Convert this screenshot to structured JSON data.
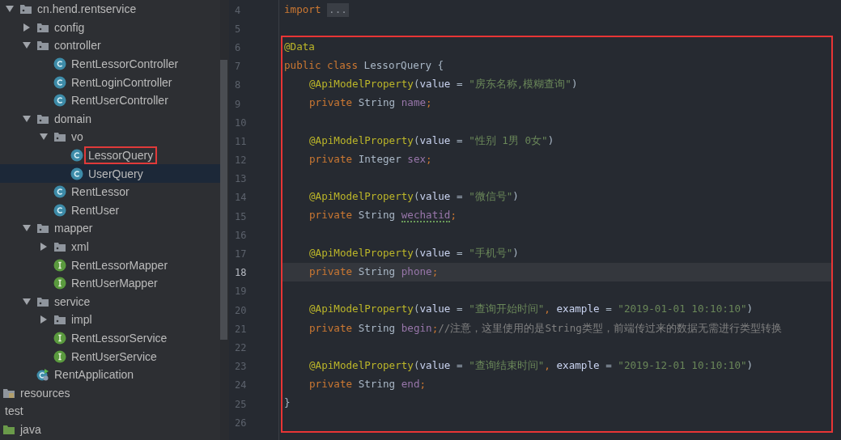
{
  "project_tree": {
    "packages": [
      {
        "label": "cn.hend.rentservice",
        "kind": "package",
        "expanded": true,
        "children": [
          {
            "label": "config",
            "kind": "package",
            "expanded": false
          },
          {
            "label": "controller",
            "kind": "package",
            "expanded": true,
            "children": [
              {
                "label": "RentLessorController",
                "kind": "class",
                "selected": false
              },
              {
                "label": "RentLoginController",
                "kind": "class",
                "selected": false
              },
              {
                "label": "RentUserController",
                "kind": "class",
                "selected": false
              }
            ]
          },
          {
            "label": "domain",
            "kind": "package",
            "expanded": true,
            "children": [
              {
                "label": "vo",
                "kind": "package",
                "expanded": true,
                "children": [
                  {
                    "label": "LessorQuery",
                    "kind": "class",
                    "selected": false,
                    "marked": true
                  },
                  {
                    "label": "UserQuery",
                    "kind": "class",
                    "selected": true
                  }
                ]
              },
              {
                "label": "RentLessor",
                "kind": "class",
                "selected": false
              },
              {
                "label": "RentUser",
                "kind": "class",
                "selected": false
              }
            ]
          },
          {
            "label": "mapper",
            "kind": "package",
            "expanded": true,
            "children": [
              {
                "label": "xml",
                "kind": "package",
                "expanded": false
              },
              {
                "label": "RentLessorMapper",
                "kind": "interface",
                "selected": false
              },
              {
                "label": "RentUserMapper",
                "kind": "interface",
                "selected": false
              }
            ]
          },
          {
            "label": "service",
            "kind": "package",
            "expanded": true,
            "children": [
              {
                "label": "impl",
                "kind": "package",
                "expanded": false
              },
              {
                "label": "RentLessorService",
                "kind": "interface",
                "selected": false
              },
              {
                "label": "RentUserService",
                "kind": "interface",
                "selected": false
              }
            ]
          },
          {
            "label": "RentApplication",
            "kind": "application",
            "selected": false
          }
        ]
      }
    ],
    "resources": {
      "label": "resources",
      "kind": "resources_folder"
    },
    "test": {
      "label": "test",
      "children": [
        {
          "label": "java",
          "kind": "source_folder"
        }
      ]
    }
  },
  "editor": {
    "lines_before": [
      {
        "number": "4",
        "tokens": [
          {
            "kind": "keyword",
            "text": "import "
          },
          {
            "kind": "folded",
            "text": "..."
          }
        ]
      },
      {
        "number": "5"
      }
    ],
    "marked_block": {
      "lines": [
        {
          "number": "6",
          "tokens": [
            {
              "kind": "annotation",
              "text": "@Data"
            }
          ]
        },
        {
          "number": "7",
          "tokens": [
            {
              "kind": "keyword",
              "text": "public class "
            },
            {
              "kind": "plain",
              "text": "LessorQuery {"
            }
          ]
        },
        {
          "number": "8",
          "indented": true,
          "tokens": [
            {
              "kind": "annotation",
              "text": "@ApiModelProperty"
            },
            {
              "kind": "plain",
              "text": "("
            },
            {
              "kind": "param",
              "text": "value"
            },
            {
              "kind": "plain",
              "text": " = "
            },
            {
              "kind": "string",
              "text": "\"房东名称,模糊查询\""
            },
            {
              "kind": "plain",
              "text": ")"
            }
          ]
        },
        {
          "number": "9",
          "indented": true,
          "tokens": [
            {
              "kind": "keyword",
              "text": "private "
            },
            {
              "kind": "plain",
              "text": "String "
            },
            {
              "kind": "field",
              "text": "name"
            },
            {
              "kind": "keyword",
              "text": ";"
            }
          ]
        },
        {
          "number": "10"
        },
        {
          "number": "11",
          "indented": true,
          "tokens": [
            {
              "kind": "annotation",
              "text": "@ApiModelProperty"
            },
            {
              "kind": "plain",
              "text": "("
            },
            {
              "kind": "param",
              "text": "value"
            },
            {
              "kind": "plain",
              "text": " = "
            },
            {
              "kind": "string",
              "text": "\"性别 1男 0女\""
            },
            {
              "kind": "plain",
              "text": ")"
            }
          ]
        },
        {
          "number": "12",
          "indented": true,
          "tokens": [
            {
              "kind": "keyword",
              "text": "private "
            },
            {
              "kind": "plain",
              "text": "Integer "
            },
            {
              "kind": "field",
              "text": "sex"
            },
            {
              "kind": "keyword",
              "text": ";"
            }
          ]
        },
        {
          "number": "13"
        },
        {
          "number": "14",
          "indented": true,
          "tokens": [
            {
              "kind": "annotation",
              "text": "@ApiModelProperty"
            },
            {
              "kind": "plain",
              "text": "("
            },
            {
              "kind": "param",
              "text": "value"
            },
            {
              "kind": "plain",
              "text": " = "
            },
            {
              "kind": "string",
              "text": "\"微信号\""
            },
            {
              "kind": "plain",
              "text": ")"
            }
          ]
        },
        {
          "number": "15",
          "indented": true,
          "tokens": [
            {
              "kind": "keyword",
              "text": "private "
            },
            {
              "kind": "plain",
              "text": "String "
            },
            {
              "kind": "field",
              "text": "wechatid",
              "warning": true
            },
            {
              "kind": "keyword",
              "text": ";"
            }
          ]
        },
        {
          "number": "16"
        },
        {
          "number": "17",
          "indented": true,
          "tokens": [
            {
              "kind": "annotation",
              "text": "@ApiModelProperty"
            },
            {
              "kind": "plain",
              "text": "("
            },
            {
              "kind": "param",
              "text": "value"
            },
            {
              "kind": "plain",
              "text": " = "
            },
            {
              "kind": "string",
              "text": "\"手机号\""
            },
            {
              "kind": "plain",
              "text": ")"
            }
          ]
        },
        {
          "number": "18",
          "indented": true,
          "current": true,
          "tokens": [
            {
              "kind": "keyword",
              "text": "private "
            },
            {
              "kind": "plain",
              "text": "String "
            },
            {
              "kind": "field",
              "text": "phone"
            },
            {
              "kind": "keyword",
              "text": ";"
            }
          ]
        },
        {
          "number": "19"
        },
        {
          "number": "20",
          "indented": true,
          "tokens": [
            {
              "kind": "annotation",
              "text": "@ApiModelProperty"
            },
            {
              "kind": "plain",
              "text": "("
            },
            {
              "kind": "param",
              "text": "value"
            },
            {
              "kind": "plain",
              "text": " = "
            },
            {
              "kind": "string",
              "text": "\"查询开始时间\""
            },
            {
              "kind": "keyword",
              "text": ", "
            },
            {
              "kind": "param",
              "text": "example"
            },
            {
              "kind": "plain",
              "text": " = "
            },
            {
              "kind": "string",
              "text": "\"2019-01-01 10:10:10\""
            },
            {
              "kind": "plain",
              "text": ")"
            }
          ]
        },
        {
          "number": "21",
          "indented": true,
          "tokens": [
            {
              "kind": "keyword",
              "text": "private "
            },
            {
              "kind": "plain",
              "text": "String "
            },
            {
              "kind": "field",
              "text": "begin"
            },
            {
              "kind": "keyword",
              "text": ";"
            },
            {
              "kind": "comment",
              "text": "//注意，这里使用的是String类型，前端传过来的数据无需进行类型转换"
            }
          ]
        },
        {
          "number": "22"
        },
        {
          "number": "23",
          "indented": true,
          "tokens": [
            {
              "kind": "annotation",
              "text": "@ApiModelProperty"
            },
            {
              "kind": "plain",
              "text": "("
            },
            {
              "kind": "param",
              "text": "value"
            },
            {
              "kind": "plain",
              "text": " = "
            },
            {
              "kind": "string",
              "text": "\"查询结束时间\""
            },
            {
              "kind": "keyword",
              "text": ", "
            },
            {
              "kind": "param",
              "text": "example"
            },
            {
              "kind": "plain",
              "text": " = "
            },
            {
              "kind": "string",
              "text": "\"2019-12-01 10:10:10\""
            },
            {
              "kind": "plain",
              "text": ")"
            }
          ]
        },
        {
          "number": "24",
          "indented": true,
          "tokens": [
            {
              "kind": "keyword",
              "text": "private "
            },
            {
              "kind": "plain",
              "text": "String "
            },
            {
              "kind": "field",
              "text": "end"
            },
            {
              "kind": "keyword",
              "text": ";"
            }
          ]
        },
        {
          "number": "25",
          "tokens": [
            {
              "kind": "plain",
              "text": "}"
            }
          ]
        },
        {
          "number": "26"
        }
      ]
    }
  }
}
